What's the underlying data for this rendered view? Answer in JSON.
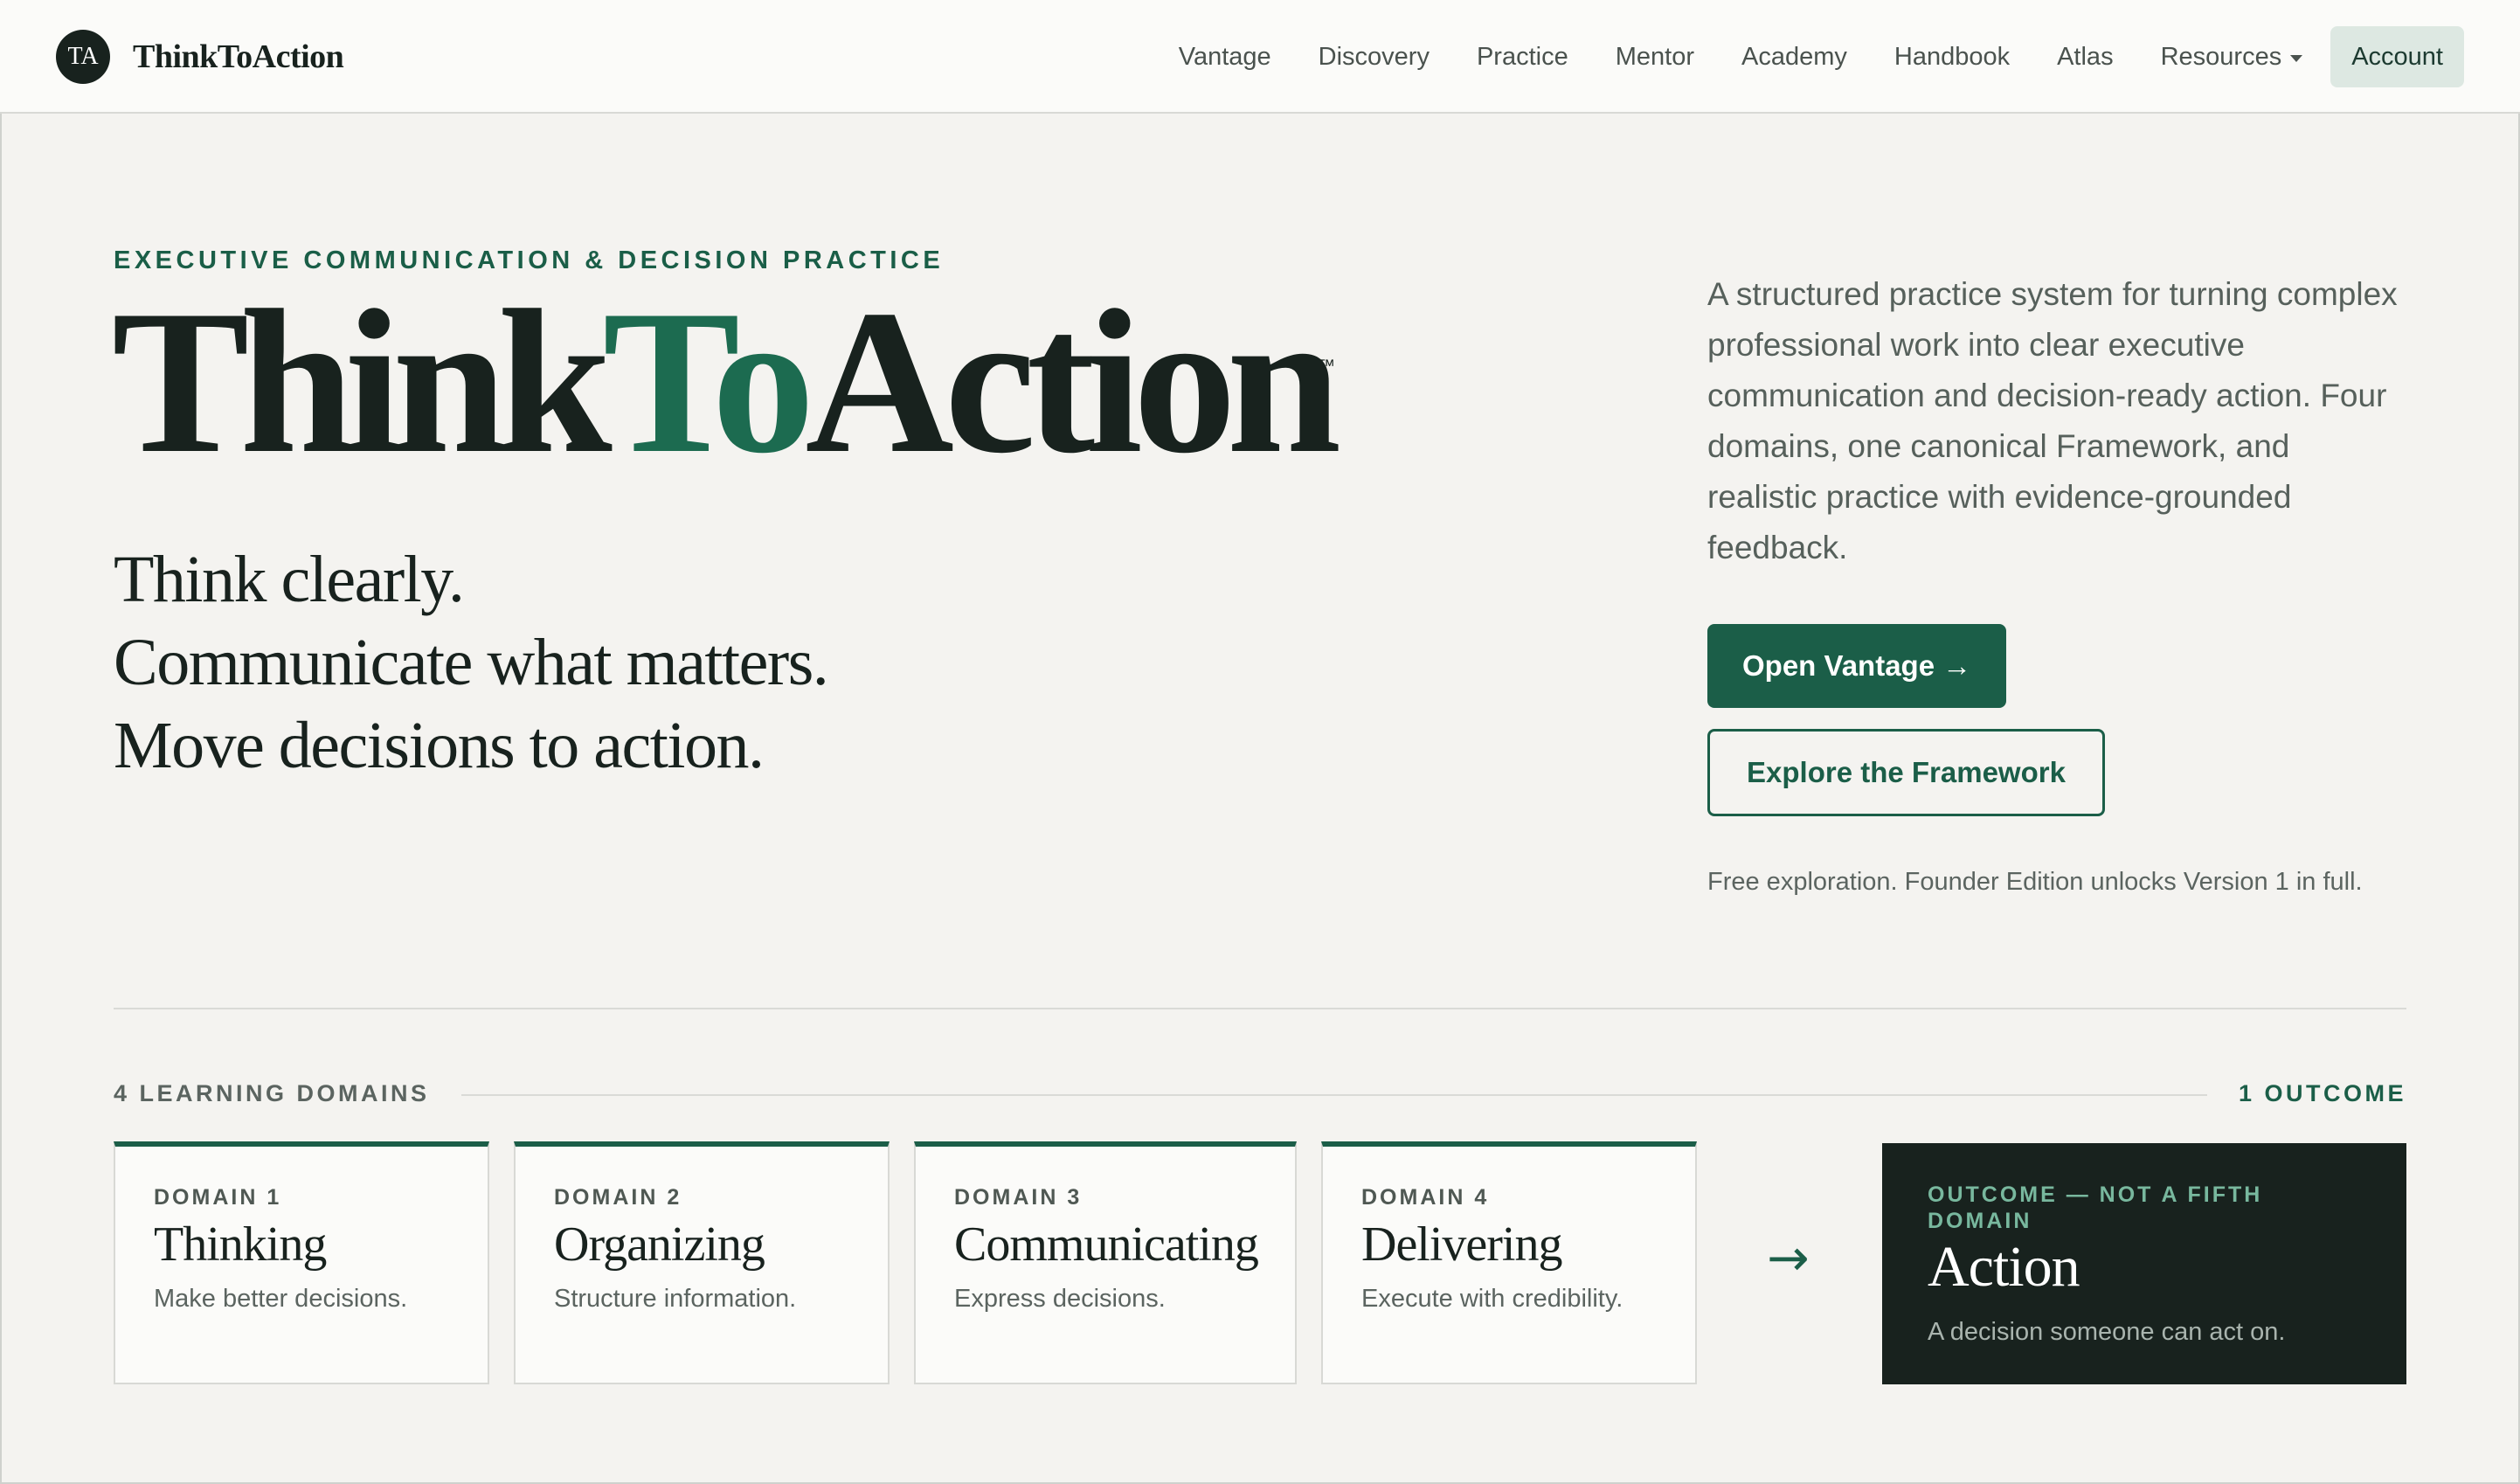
{
  "nav": {
    "brand_mark": "TA",
    "brand_name": "ThinkToAction",
    "links": [
      "Vantage",
      "Discovery",
      "Practice",
      "Mentor",
      "Academy",
      "Handbook",
      "Atlas"
    ],
    "resources_label": "Resources",
    "account_label": "Account"
  },
  "hero": {
    "eyebrow": "EXECUTIVE COMMUNICATION & DECISION PRACTICE",
    "wordmark_part1": "Think",
    "wordmark_part2": "To",
    "wordmark_part3": "Action",
    "trademark": "™",
    "tagline": [
      "Think clearly.",
      "Communicate what matters.",
      "Move decisions to action."
    ],
    "intro": "A structured practice system for turning complex professional work into clear executive communication and decision-ready action. Four domains, one canonical Framework, and realistic practice with evidence-grounded feedback.",
    "primary_cta": "Open Vantage →",
    "secondary_cta": "Explore the Framework",
    "fine_print": "Free exploration. Founder Edition unlocks Version 1 in full."
  },
  "domains": {
    "label": "4 LEARNING DOMAINS",
    "outcome_label": "1 OUTCOME",
    "items": [
      {
        "eyebrow": "DOMAIN 1",
        "title": "Thinking",
        "desc": "Make better decisions."
      },
      {
        "eyebrow": "DOMAIN 2",
        "title": "Organizing",
        "desc": "Structure information."
      },
      {
        "eyebrow": "DOMAIN 3",
        "title": "Communicating",
        "desc": "Express decisions."
      },
      {
        "eyebrow": "DOMAIN 4",
        "title": "Delivering",
        "desc": "Execute with credibility."
      }
    ],
    "arrow": "→",
    "outcome": {
      "eyebrow": "OUTCOME — NOT A FIFTH DOMAIN",
      "title": "Action",
      "desc": "A decision someone can act on."
    }
  },
  "colors": {
    "accent": "#1b5e48",
    "background": "#f4f3f0",
    "ink": "#18221e"
  }
}
